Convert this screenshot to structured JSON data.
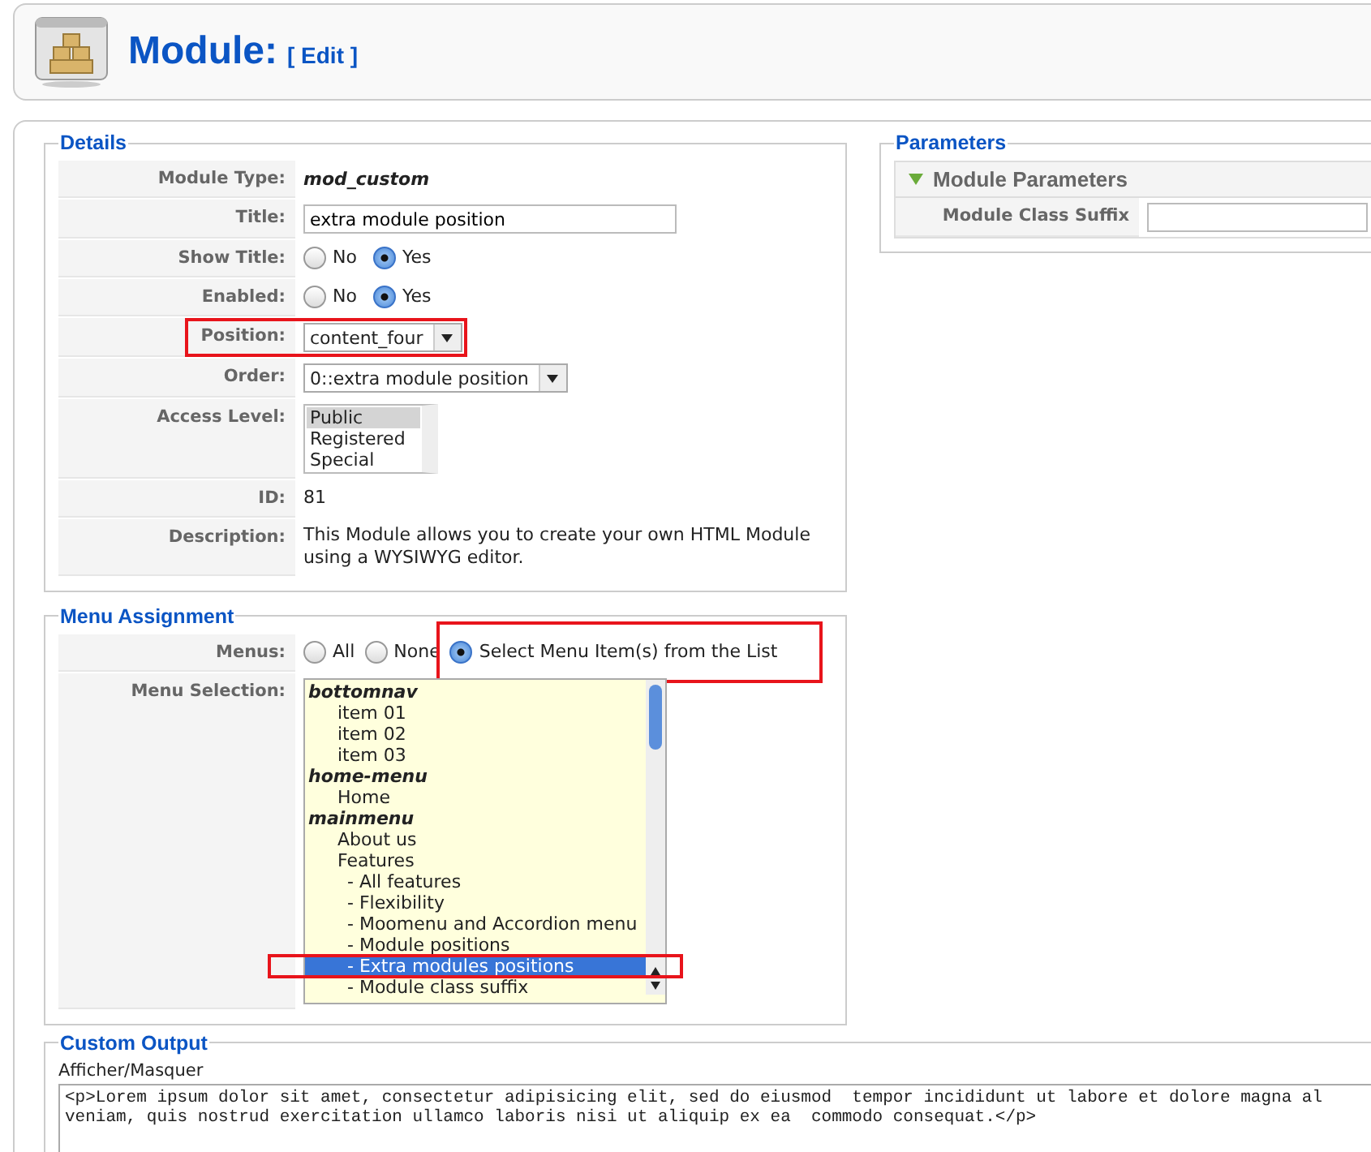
{
  "header": {
    "title": "Module:",
    "subtitle": "[ Edit ]"
  },
  "details": {
    "legend": "Details",
    "rows": [
      {
        "kind": "code",
        "label": "Module Type:",
        "value": "mod_custom",
        "highlighted": false
      },
      {
        "kind": "input",
        "label": "Title:",
        "value": "extra module position",
        "highlighted": false
      },
      {
        "kind": "radio",
        "label": "Show Title:",
        "options": [
          {
            "label": "No",
            "selected": false
          },
          {
            "label": "Yes",
            "selected": true
          }
        ],
        "highlighted": false
      },
      {
        "kind": "radio",
        "label": "Enabled:",
        "options": [
          {
            "label": "No",
            "selected": false
          },
          {
            "label": "Yes",
            "selected": true
          }
        ],
        "highlighted": false
      },
      {
        "kind": "select",
        "label": "Position:",
        "value": "content_four",
        "highlighted": true
      },
      {
        "kind": "select",
        "label": "Order:",
        "value": "0::extra module position",
        "highlighted": false
      },
      {
        "kind": "listbox",
        "label": "Access Level:",
        "options": [
          {
            "label": "Public",
            "selected": true
          },
          {
            "label": "Registered",
            "selected": false
          },
          {
            "label": "Special",
            "selected": false
          }
        ],
        "highlighted": false
      },
      {
        "kind": "text",
        "label": "ID:",
        "value": "81",
        "highlighted": false
      },
      {
        "kind": "text",
        "label": "Description:",
        "value": "This Module allows you to create your own HTML Module using a WYSIWYG editor.",
        "highlighted": false
      }
    ]
  },
  "parameters": {
    "legend": "Parameters",
    "pane": {
      "title": "Module Parameters",
      "expanded": true,
      "rows": [
        {
          "label": "Module Class Suffix",
          "value": ""
        }
      ]
    }
  },
  "menu_assignment": {
    "legend": "Menu Assignment",
    "menus_label": "Menus:",
    "menus": [
      {
        "label": "All",
        "selected": false,
        "highlighted": false
      },
      {
        "label": "None",
        "selected": false,
        "highlighted": false
      },
      {
        "label": "Select Menu Item(s) from the List",
        "selected": true,
        "highlighted": true
      }
    ],
    "selection_label": "Menu Selection:",
    "menu_tree": [
      {
        "kind": "group",
        "label": "bottomnav",
        "selected": false,
        "highlighted": false,
        "children": [
          {
            "kind": "item",
            "label": "item 01",
            "selected": false,
            "highlighted": false
          },
          {
            "kind": "item",
            "label": "item 02",
            "selected": false,
            "highlighted": false
          },
          {
            "kind": "item",
            "label": "item 03",
            "selected": false,
            "highlighted": false
          }
        ]
      },
      {
        "kind": "group",
        "label": "home-menu",
        "selected": false,
        "highlighted": false,
        "children": [
          {
            "kind": "item",
            "label": "Home",
            "selected": false,
            "highlighted": false
          }
        ]
      },
      {
        "kind": "group",
        "label": "mainmenu",
        "selected": false,
        "highlighted": false,
        "children": [
          {
            "kind": "item",
            "label": "About us",
            "selected": false,
            "highlighted": false
          },
          {
            "kind": "item",
            "label": "Features",
            "selected": false,
            "highlighted": false,
            "children": [
              {
                "kind": "item",
                "label": "- All features",
                "selected": false,
                "highlighted": false
              },
              {
                "kind": "item",
                "label": "- Flexibility",
                "selected": false,
                "highlighted": false
              },
              {
                "kind": "item",
                "label": "- Moomenu and Accordion menu",
                "selected": false,
                "highlighted": false
              },
              {
                "kind": "item",
                "label": "- Module positions",
                "selected": false,
                "highlighted": false
              },
              {
                "kind": "item",
                "label": "- Extra modules positions",
                "selected": true,
                "highlighted": true
              },
              {
                "kind": "item",
                "label": "- Module class suffix",
                "selected": false,
                "highlighted": false
              }
            ]
          }
        ]
      }
    ]
  },
  "custom_output": {
    "legend": "Custom Output",
    "toggle": "Afficher/Masquer",
    "value": "<p>Lorem ipsum dolor sit amet, consectetur adipisicing elit, sed do eiusmod  tempor incididunt ut labore et dolore magna al\nveniam, quis nostrud exercitation ullamco laboris nisi ut aliquip ex ea  commodo consequat.</p>"
  }
}
